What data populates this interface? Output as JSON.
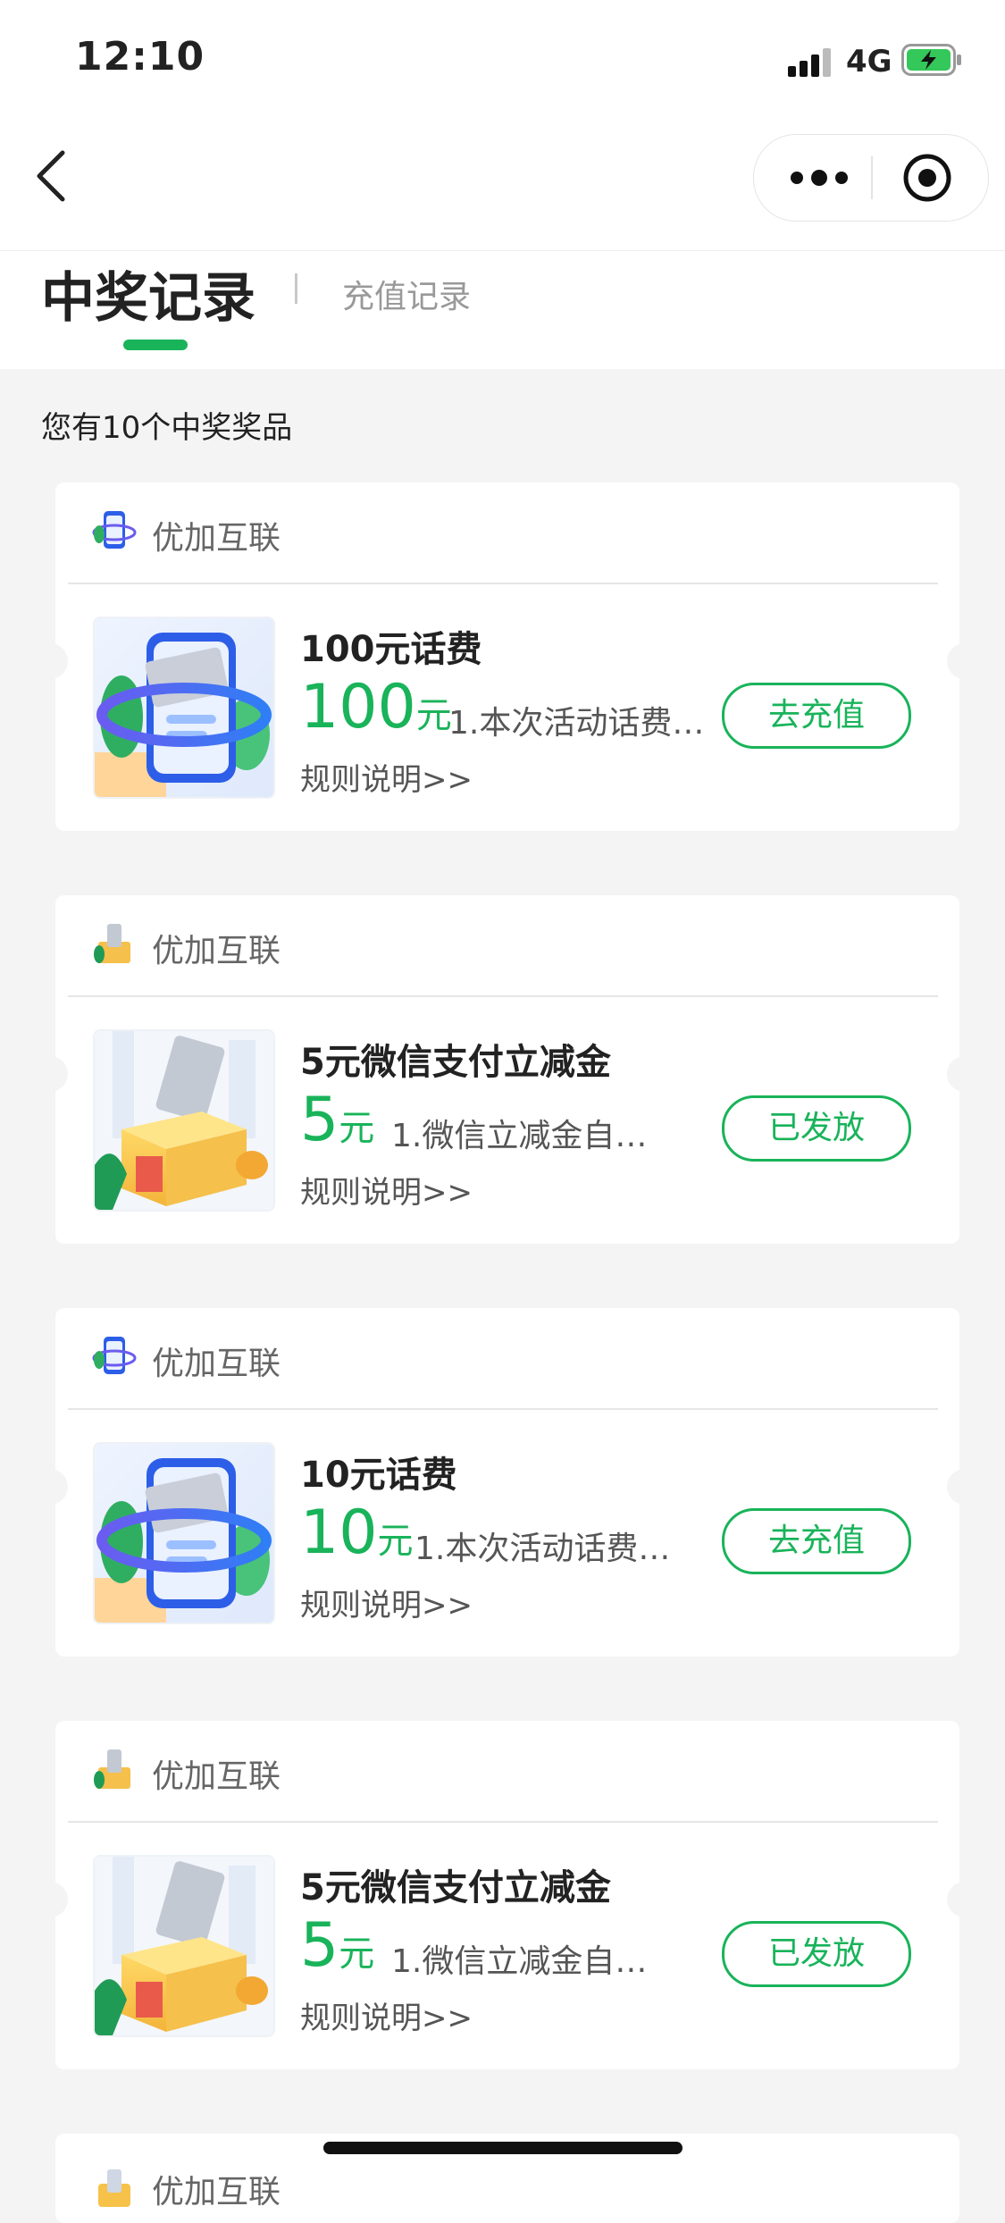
{
  "status_bar": {
    "time": "12:10",
    "network": "4G"
  },
  "tabs": {
    "active": "中奖记录",
    "inactive": "充值记录"
  },
  "summary": "您有10个中奖奖品",
  "colors": {
    "accent": "#19b35a",
    "background": "#f4f4f4"
  },
  "prizes": [
    {
      "shop": "优加互联",
      "shop_icon": "phone-card-icon",
      "thumb": "phone-recharge",
      "title": "100元话费",
      "amount": "100",
      "unit": "元",
      "desc": "1.本次活动话费…",
      "rules": "规则说明>>",
      "button": "去充值"
    },
    {
      "shop": "优加互联",
      "shop_icon": "gift-box-icon",
      "thumb": "wechat-voucher",
      "title": "5元微信支付立减金",
      "amount": "5",
      "unit": "元",
      "desc": "1.微信立减金自…",
      "rules": "规则说明>>",
      "button": "已发放"
    },
    {
      "shop": "优加互联",
      "shop_icon": "phone-card-icon",
      "thumb": "phone-recharge",
      "title": "10元话费",
      "amount": "10",
      "unit": "元",
      "desc": "1.本次活动话费…",
      "rules": "规则说明>>",
      "button": "去充值"
    },
    {
      "shop": "优加互联",
      "shop_icon": "gift-box-icon",
      "thumb": "wechat-voucher",
      "title": "5元微信支付立减金",
      "amount": "5",
      "unit": "元",
      "desc": "1.微信立减金自…",
      "rules": "规则说明>>",
      "button": "已发放"
    },
    {
      "shop": "优加互联",
      "shop_icon": "gift-box-icon"
    }
  ]
}
